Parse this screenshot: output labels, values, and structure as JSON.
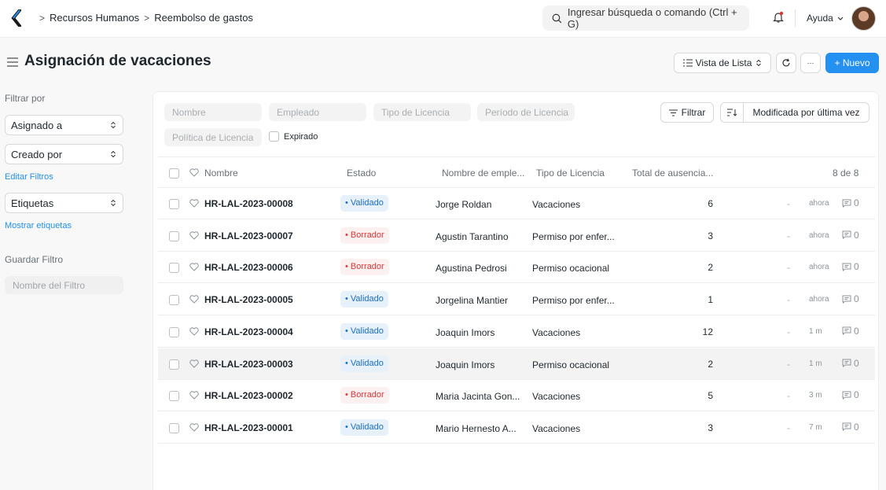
{
  "breadcrumbs": [
    "Recursos Humanos",
    "Reembolso de gastos"
  ],
  "search": {
    "placeholder": "Ingresar búsqueda o comando (Ctrl + G)"
  },
  "help_label": "Ayuda",
  "page": {
    "title": "Asignación de vacaciones"
  },
  "header_buttons": {
    "list_view": "Vista de Lista",
    "more": "···",
    "new": "+ Nuevo"
  },
  "sidebar": {
    "filter_by": "Filtrar por",
    "assigned_to": "Asignado a",
    "created_by": "Creado por",
    "edit_filters": "Editar Filtros",
    "tags": "Etiquetas",
    "show_tags": "Mostrar etiquetas",
    "save_filter": "Guardar Filtro",
    "filter_name_placeholder": "Nombre del Filtro"
  },
  "filters": {
    "name": "Nombre",
    "employee": "Empleado",
    "leave_type": "Tipo de Licencia",
    "leave_period": "Período de Licencia",
    "leave_policy": "Política de Licencia",
    "expired": "Expirado",
    "filter_button": "Filtrar",
    "sort_label": "Modificada por última vez"
  },
  "table": {
    "headers": {
      "name": "Nombre",
      "status": "Estado",
      "employee_name": "Nombre de emple...",
      "leave_type": "Tipo de Licencia",
      "total": "Total de ausencia...",
      "count": "8 de 8"
    },
    "rows": [
      {
        "id": "HR-LAL-2023-00008",
        "status": "• Validado",
        "status_kind": "ok",
        "employee": "Jorge Roldan",
        "leave_type": "Vacaciones",
        "total": "6",
        "dash": "-",
        "modified": "ahora",
        "comments": "0"
      },
      {
        "id": "HR-LAL-2023-00007",
        "status": "• Borrador",
        "status_kind": "draft",
        "employee": "Agustin Tarantino",
        "leave_type": "Permiso por enfer...",
        "total": "3",
        "dash": "-",
        "modified": "ahora",
        "comments": "0"
      },
      {
        "id": "HR-LAL-2023-00006",
        "status": "• Borrador",
        "status_kind": "draft",
        "employee": "Agustina Pedrosi",
        "leave_type": "Permiso ocacional",
        "total": "2",
        "dash": "-",
        "modified": "ahora",
        "comments": "0"
      },
      {
        "id": "HR-LAL-2023-00005",
        "status": "• Validado",
        "status_kind": "ok",
        "employee": "Jorgelina Mantier",
        "leave_type": "Permiso por enfer...",
        "total": "1",
        "dash": "-",
        "modified": "ahora",
        "comments": "0"
      },
      {
        "id": "HR-LAL-2023-00004",
        "status": "• Validado",
        "status_kind": "ok",
        "employee": "Joaquin Imors",
        "leave_type": "Vacaciones",
        "total": "12",
        "dash": "-",
        "modified": "1 m",
        "comments": "0"
      },
      {
        "id": "HR-LAL-2023-00003",
        "status": "• Validado",
        "status_kind": "ok",
        "employee": "Joaquin Imors",
        "leave_type": "Permiso ocacional",
        "total": "2",
        "dash": "-",
        "modified": "1 m",
        "comments": "0"
      },
      {
        "id": "HR-LAL-2023-00002",
        "status": "• Borrador",
        "status_kind": "draft",
        "employee": "Maria Jacinta Gon...",
        "leave_type": "Vacaciones",
        "total": "5",
        "dash": "-",
        "modified": "3 m",
        "comments": "0"
      },
      {
        "id": "HR-LAL-2023-00001",
        "status": "• Validado",
        "status_kind": "ok",
        "employee": "Mario Hernesto A...",
        "leave_type": "Vacaciones",
        "total": "3",
        "dash": "-",
        "modified": "7 m",
        "comments": "0"
      }
    ],
    "highlighted_row": 5
  },
  "colors": {
    "primary": "#2490ef",
    "validated_bg": "#e6f1fb",
    "validated_text": "#1c6fc2",
    "draft_bg": "#fdf0f0",
    "draft_text": "#e03636"
  }
}
